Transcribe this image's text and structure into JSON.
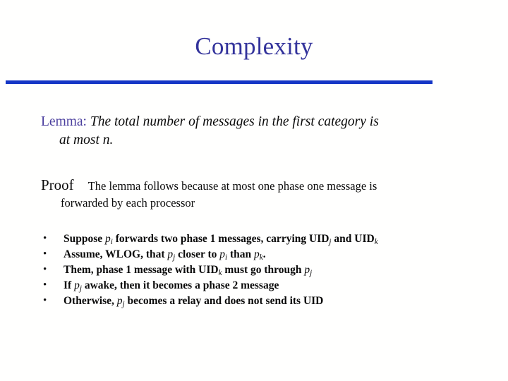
{
  "slide": {
    "title": "Complexity",
    "title_color": "#33339b",
    "divider_color": "#1536c6",
    "background_color": "#fffffe"
  },
  "lemma": {
    "label": "Lemma:",
    "label_color": "#4b3f9e",
    "statement_line1": "The total number of messages in the first category is",
    "statement_line2": "at most n."
  },
  "proof": {
    "label": "Proof",
    "line1": "The lemma follows because at most one phase one message is",
    "line2": "forwarded by each processor"
  },
  "bullets": {
    "marker": "•",
    "items": [
      {
        "id": "bullet-suppose",
        "plain": "Suppose pi forwards two phase 1 messages, carrying UIDj and UIDk",
        "parts": [
          {
            "t": "Suppose ",
            "style": "bold"
          },
          {
            "t": "p",
            "style": "var"
          },
          {
            "t": "i",
            "style": "sub"
          },
          {
            "t": " forwards two phase 1 messages, carrying ",
            "style": "bold"
          },
          {
            "t": "UID",
            "style": "bold"
          },
          {
            "t": "j",
            "style": "sub"
          },
          {
            "t": " and ",
            "style": "bold"
          },
          {
            "t": "UID",
            "style": "bold"
          },
          {
            "t": "k",
            "style": "sub"
          }
        ]
      },
      {
        "id": "bullet-assume",
        "plain": "Assume, WLOG, that pj closer to pi than pk.",
        "parts": [
          {
            "t": "Assume, WLOG, that ",
            "style": "bold"
          },
          {
            "t": "p",
            "style": "var"
          },
          {
            "t": "j",
            "style": "sub"
          },
          {
            "t": " closer to ",
            "style": "bold"
          },
          {
            "t": "p",
            "style": "var"
          },
          {
            "t": "i",
            "style": "sub"
          },
          {
            "t": " than ",
            "style": "bold"
          },
          {
            "t": "p",
            "style": "var"
          },
          {
            "t": "k",
            "style": "sub"
          },
          {
            "t": ".",
            "style": "bold"
          }
        ]
      },
      {
        "id": "bullet-them",
        "plain": "Them, phase 1 message with UIDk must go through pj",
        "parts": [
          {
            "t": "Them, phase 1 message with ",
            "style": "bold"
          },
          {
            "t": "UID",
            "style": "bold"
          },
          {
            "t": "k",
            "style": "sub"
          },
          {
            "t": " must go through ",
            "style": "bold"
          },
          {
            "t": "p",
            "style": "var"
          },
          {
            "t": "j",
            "style": "sub"
          }
        ]
      },
      {
        "id": "bullet-if-awake",
        "plain": "If pj awake, then it becomes a phase 2 message",
        "parts": [
          {
            "t": "If ",
            "style": "bold"
          },
          {
            "t": "p",
            "style": "var"
          },
          {
            "t": "j",
            "style": "sub"
          },
          {
            "t": " awake, then it becomes a phase 2 message",
            "style": "bold"
          }
        ]
      },
      {
        "id": "bullet-otherwise",
        "plain": "Otherwise, pj becomes a relay and does not send its UID",
        "parts": [
          {
            "t": "Otherwise, ",
            "style": "bold"
          },
          {
            "t": "p",
            "style": "var"
          },
          {
            "t": "j",
            "style": "sub"
          },
          {
            "t": " becomes a relay and does not send its UID",
            "style": "bold"
          }
        ]
      }
    ]
  }
}
